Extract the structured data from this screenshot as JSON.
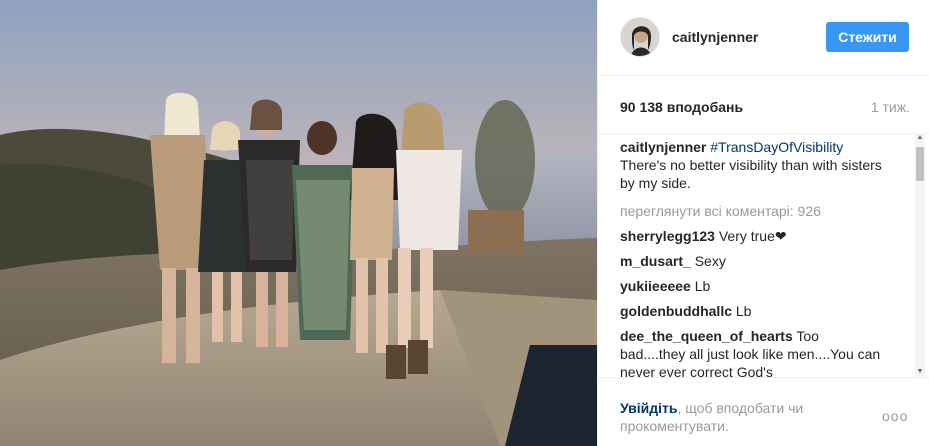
{
  "post": {
    "photo_alt": "",
    "author": {
      "username": "caitlynjenner",
      "avatar_icon": "avatar-photo"
    },
    "follow_label": "Стежити",
    "likes": "90 138 вподобань",
    "time": "1 тиж.",
    "caption": {
      "username": "caitlynjenner",
      "hashtag": "#TransDayOfVisibility",
      "text": "There's no better visibility than with sisters by my side."
    },
    "view_all_comments": "переглянути всі коментарі: 926",
    "comments": [
      {
        "username": "sherrylegg123",
        "text": "Very true❤"
      },
      {
        "username": "m_dusart_",
        "text": "Sexy"
      },
      {
        "username": "yukiieeeee",
        "text": "Lb"
      },
      {
        "username": "goldenbuddhallc",
        "text": "Lb"
      },
      {
        "username": "dee_the_queen_of_hearts",
        "text": "Too bad....they all just look like men....You can never ever correct God's"
      }
    ],
    "footer": {
      "login_link": "Увійдіть",
      "login_suffix": ", щоб вподобати чи прокоментувати."
    },
    "more_icon": "ellipsis-icon",
    "more_label": "ооо"
  },
  "colors": {
    "accent": "#3897f0",
    "link": "#003569",
    "muted": "#999999",
    "text": "#262626"
  }
}
